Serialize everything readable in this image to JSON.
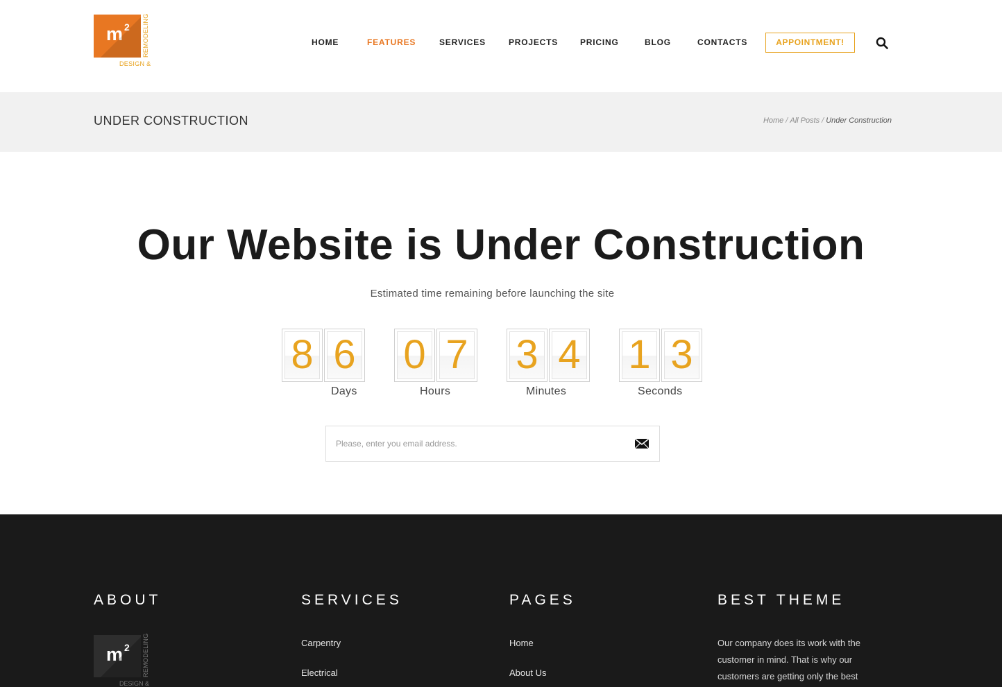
{
  "logo": {
    "mark": "m",
    "sup": "2",
    "vertical_text": "REMODELING",
    "bottom_text": "DESIGN &"
  },
  "nav": {
    "items": [
      {
        "label": "HOME",
        "active": false
      },
      {
        "label": "FEATURES",
        "active": true
      },
      {
        "label": "SERVICES",
        "active": false
      },
      {
        "label": "PROJECTS",
        "active": false
      },
      {
        "label": "PRICING",
        "active": false
      },
      {
        "label": "BLOG",
        "active": false
      },
      {
        "label": "CONTACTS",
        "active": false
      }
    ],
    "appointment_label": "APPOINTMENT!"
  },
  "titlebar": {
    "title": "UNDER CONSTRUCTION",
    "breadcrumb": {
      "home": "Home",
      "sep": "/",
      "posts": "All Posts",
      "current": "Under Construction"
    }
  },
  "main": {
    "headline": "Our Website is Under Construction",
    "subline": "Estimated time remaining before launching the site",
    "countdown": [
      {
        "digits": [
          "8",
          "6"
        ],
        "label": "Days"
      },
      {
        "digits": [
          "0",
          "7"
        ],
        "label": "Hours"
      },
      {
        "digits": [
          "3",
          "4"
        ],
        "label": "Minutes"
      },
      {
        "digits": [
          "1",
          "3"
        ],
        "label": "Seconds"
      }
    ],
    "email": {
      "placeholder": "Please, enter you email address.",
      "value": ""
    }
  },
  "footer": {
    "about": {
      "heading": "ABOUT"
    },
    "services": {
      "heading": "SERVICES",
      "links": [
        "Carpentry",
        "Electrical"
      ]
    },
    "pages": {
      "heading": "PAGES",
      "links": [
        "Home",
        "About Us"
      ]
    },
    "best_theme": {
      "heading": "BEST THEME",
      "text": "Our company does its work with the customer in mind. That is why our customers are getting only the best"
    }
  },
  "colors": {
    "accent_orange": "#e87722",
    "accent_yellow": "#e8a31f",
    "footer_bg": "#1a1a1a",
    "titlebar_bg": "#f1f1f1"
  }
}
